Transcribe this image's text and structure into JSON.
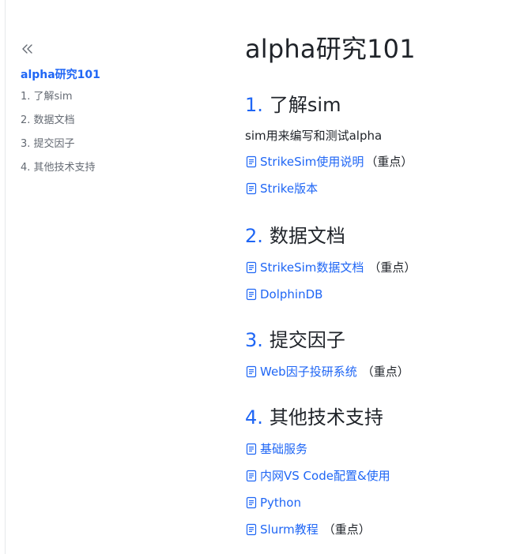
{
  "toc": {
    "collapse_icon": "double-chevron-left-icon",
    "title": "alpha研究101",
    "items": [
      "1. 了解sim",
      "2. 数据文档",
      "3. 提交因子",
      "4. 其他技术支持"
    ]
  },
  "doc": {
    "title": "alpha研究101",
    "sections": [
      {
        "num": "1.",
        "heading": "了解sim",
        "paragraph": "sim用来编写和测试alpha",
        "links": [
          {
            "label": "StrikeSim使用说明",
            "note": "（重点）"
          },
          {
            "label": "Strike版本",
            "note": ""
          }
        ]
      },
      {
        "num": "2.",
        "heading": "数据文档",
        "links": [
          {
            "label": "StrikeSim数据文档",
            "note": "（重点）"
          },
          {
            "label": "DolphinDB",
            "note": ""
          }
        ]
      },
      {
        "num": "3.",
        "heading": "提交因子",
        "links": [
          {
            "label": "Web因子投研系统",
            "note": "（重点）"
          }
        ]
      },
      {
        "num": "4.",
        "heading": "其他技术支持",
        "links": [
          {
            "label": "基础服务",
            "note": ""
          },
          {
            "label": "内网VS Code配置&使用",
            "note": ""
          },
          {
            "label": "Python",
            "note": ""
          },
          {
            "label": "Slurm教程",
            "note": "（重点）"
          }
        ]
      }
    ]
  },
  "colors": {
    "accent": "#1f66f5",
    "text": "#1f2329",
    "muted": "#646a73"
  }
}
